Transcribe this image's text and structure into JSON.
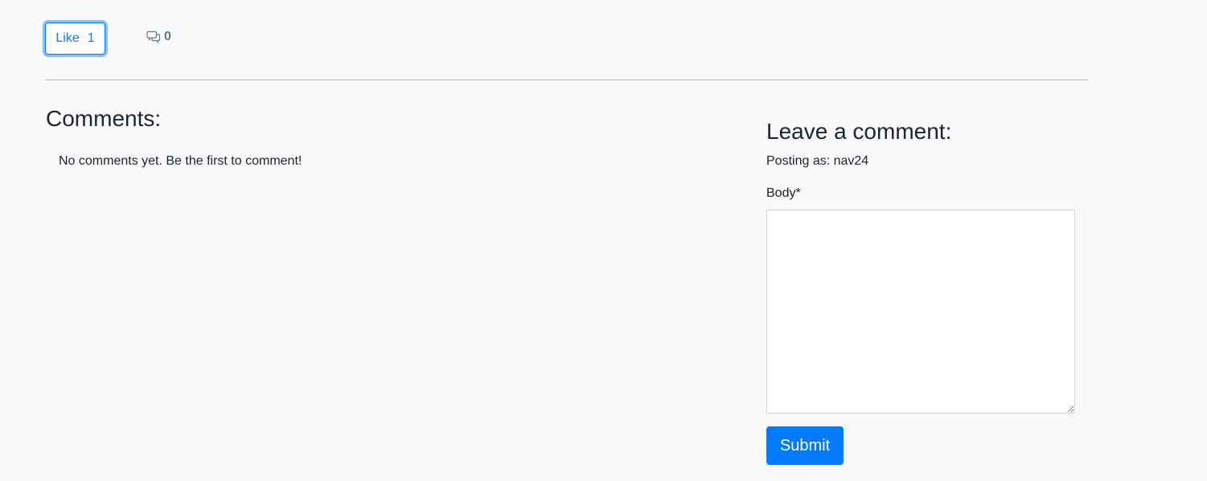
{
  "actions": {
    "like_label": "Like",
    "like_count": "1",
    "comment_count": "0"
  },
  "comments": {
    "heading": "Comments:",
    "empty_message": "No comments yet. Be the first to comment!"
  },
  "form": {
    "heading": "Leave a comment:",
    "posting_as": "Posting as: nav24",
    "body_label": "Body*",
    "body_value": "",
    "submit_label": "Submit"
  },
  "colors": {
    "primary": "#007bff",
    "background": "#f8f9fa",
    "muted": "#6c757d"
  },
  "icons": {
    "comments": "comments-icon"
  }
}
